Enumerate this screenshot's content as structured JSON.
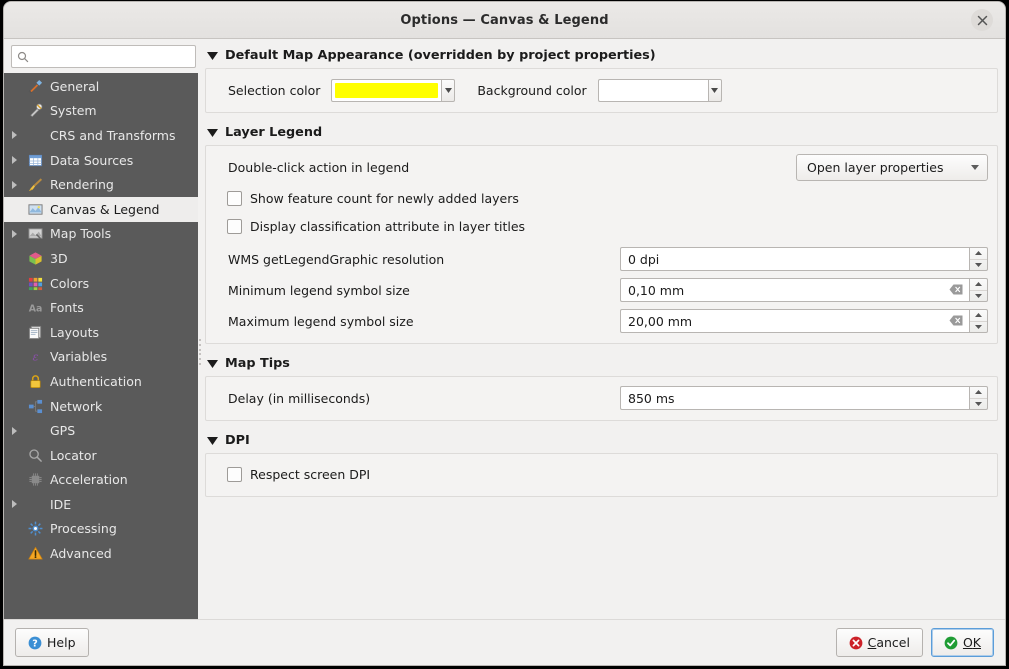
{
  "window": {
    "title": "Options — Canvas & Legend",
    "close_icon": "close-icon"
  },
  "sidebar": {
    "search": {
      "value": "",
      "placeholder": "",
      "icon": "search-icon"
    },
    "items": [
      {
        "label": "General",
        "icon": "hammer-wrench-icon",
        "expandable": false,
        "selected": false
      },
      {
        "label": "System",
        "icon": "tools-icon",
        "expandable": false,
        "selected": false
      },
      {
        "label": "CRS and Transforms",
        "icon": "none",
        "expandable": true,
        "selected": false
      },
      {
        "label": "Data Sources",
        "icon": "table-icon",
        "expandable": true,
        "selected": false
      },
      {
        "label": "Rendering",
        "icon": "paintbrush-icon",
        "expandable": true,
        "selected": false
      },
      {
        "label": "Canvas & Legend",
        "icon": "canvas-legend-icon",
        "expandable": false,
        "selected": true
      },
      {
        "label": "Map Tools",
        "icon": "map-tools-icon",
        "expandable": true,
        "selected": false
      },
      {
        "label": "3D",
        "icon": "cube-icon",
        "expandable": false,
        "selected": false
      },
      {
        "label": "Colors",
        "icon": "color-palette-icon",
        "expandable": false,
        "selected": false
      },
      {
        "label": "Fonts",
        "icon": "fonts-aa-icon",
        "expandable": false,
        "selected": false
      },
      {
        "label": "Layouts",
        "icon": "layouts-page-icon",
        "expandable": false,
        "selected": false
      },
      {
        "label": "Variables",
        "icon": "epsilon-variable-icon",
        "expandable": false,
        "selected": false
      },
      {
        "label": "Authentication",
        "icon": "lock-icon",
        "expandable": false,
        "selected": false
      },
      {
        "label": "Network",
        "icon": "network-nodes-icon",
        "expandable": false,
        "selected": false
      },
      {
        "label": "GPS",
        "icon": "none",
        "expandable": true,
        "selected": false
      },
      {
        "label": "Locator",
        "icon": "magnifier-icon",
        "expandable": false,
        "selected": false
      },
      {
        "label": "Acceleration",
        "icon": "chip-icon",
        "expandable": false,
        "selected": false
      },
      {
        "label": "IDE",
        "icon": "none",
        "expandable": true,
        "selected": false
      },
      {
        "label": "Processing",
        "icon": "gear-sun-icon",
        "expandable": false,
        "selected": false
      },
      {
        "label": "Advanced",
        "icon": "warning-triangle-icon",
        "expandable": false,
        "selected": false
      }
    ]
  },
  "sections": {
    "map_appearance": {
      "title": "Default Map Appearance (overridden by project properties)",
      "selection_color_label": "Selection color",
      "selection_color_value": "#ffff00",
      "background_color_label": "Background color",
      "background_color_value": "#ffffff"
    },
    "layer_legend": {
      "title": "Layer Legend",
      "double_click_label": "Double-click action in legend",
      "double_click_value": "Open layer properties",
      "show_feature_count_label": "Show feature count for newly added layers",
      "show_feature_count_checked": false,
      "display_classification_label": "Display classification attribute in layer titles",
      "display_classification_checked": false,
      "wms_resolution_label": "WMS getLegendGraphic resolution",
      "wms_resolution_value": "0 dpi",
      "min_symbol_label": "Minimum legend symbol size",
      "min_symbol_value": "0,10 mm",
      "max_symbol_label": "Maximum legend symbol size",
      "max_symbol_value": "20,00 mm",
      "clear_icon": "clear-field-icon"
    },
    "map_tips": {
      "title": "Map Tips",
      "delay_label": "Delay (in milliseconds)",
      "delay_value": "850 ms"
    },
    "dpi": {
      "title": "DPI",
      "respect_label": "Respect screen DPI",
      "respect_checked": false
    }
  },
  "footer": {
    "help_label": "Help",
    "help_icon": "help-circle-icon",
    "cancel_label_a": "C",
    "cancel_label_b": "ancel",
    "cancel_icon": "cancel-x-icon",
    "ok_label_a": "O",
    "ok_label_b": "K",
    "ok_icon": "ok-check-icon"
  },
  "colors": {
    "sidebar_bg": "#5a5a5a",
    "dialog_bg": "#f2f1f0",
    "selection_yellow": "#ffff00",
    "ok_green": "#1f9c34",
    "cancel_red": "#cc2128",
    "accent_blue": "#5b9dd9"
  }
}
